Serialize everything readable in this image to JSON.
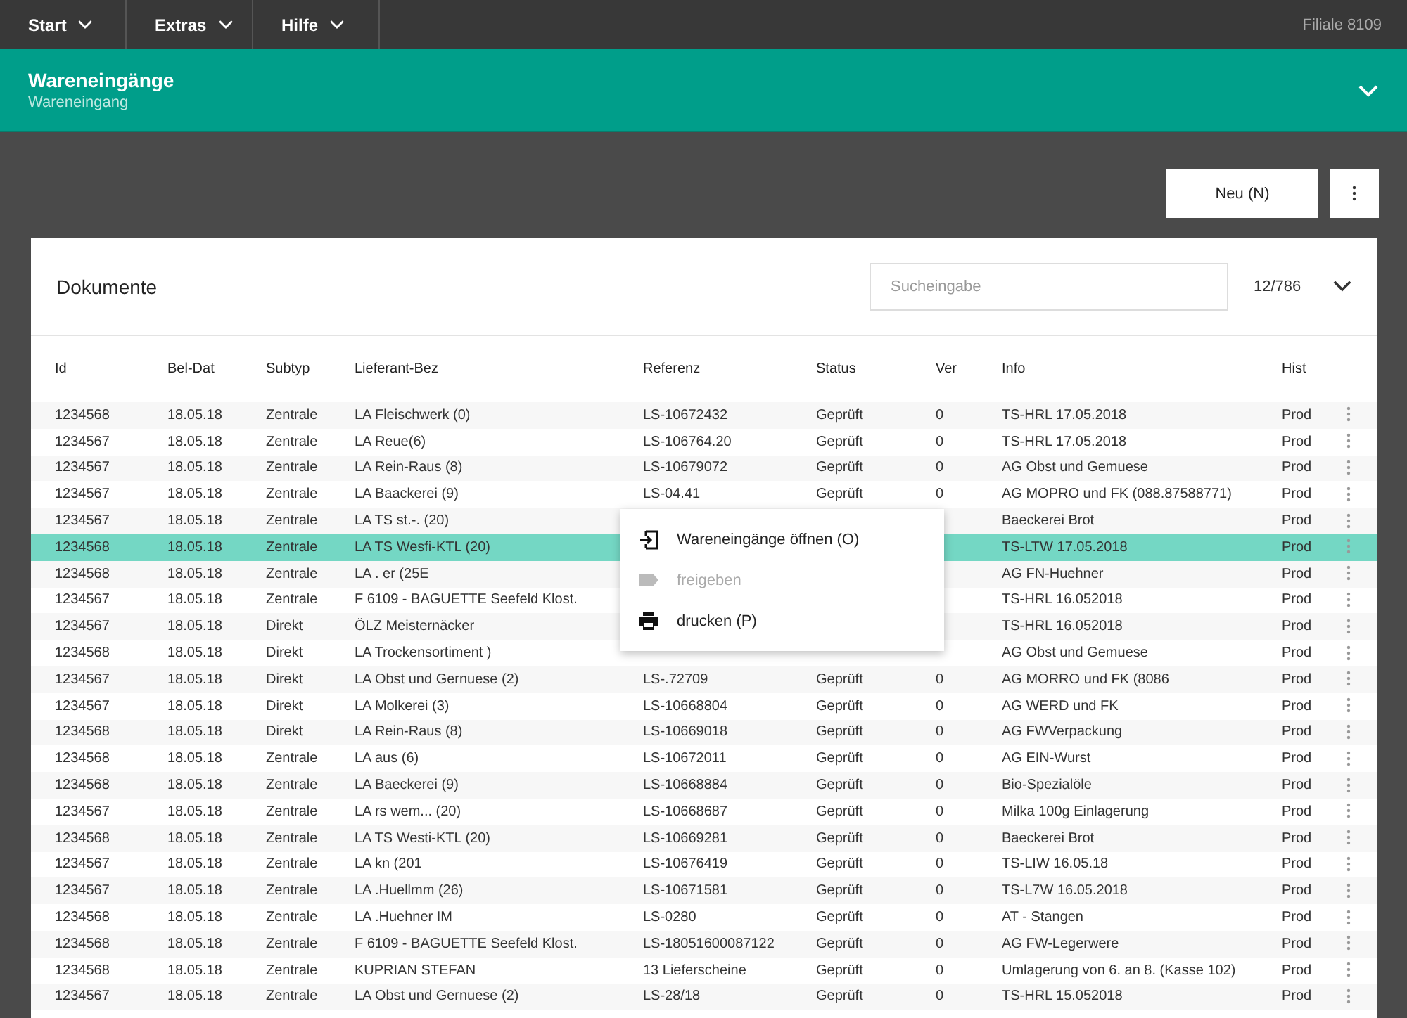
{
  "topbar": {
    "menus": [
      {
        "label": "Start"
      },
      {
        "label": "Extras"
      },
      {
        "label": "Hilfe"
      }
    ],
    "branch": "Filiale 8109"
  },
  "header": {
    "title": "Wareneingänge",
    "subtitle": "Wareneingang"
  },
  "actions": {
    "new_button": "Neu (N)"
  },
  "documents": {
    "title": "Dokumente",
    "search": {
      "placeholder": "Sucheingabe"
    },
    "count": "12/786",
    "columns": [
      "Id",
      "Bel-Dat",
      "Subtyp",
      "Lieferant-Bez",
      "Referenz",
      "Status",
      "Ver",
      "Info",
      "Hist"
    ],
    "rows": [
      {
        "selected": false,
        "cells": [
          "1234568",
          "18.05.18",
          "Zentrale",
          "LA Fleischwerk (0)",
          "LS-10672432",
          "Geprüft",
          "0",
          "TS-HRL 17.05.2018",
          "Prod"
        ]
      },
      {
        "selected": false,
        "cells": [
          "1234567",
          "18.05.18",
          "Zentrale",
          "LA Reue(6)",
          "LS-106764.20",
          "Geprüft",
          "0",
          "TS-HRL 17.05.2018",
          "Prod"
        ]
      },
      {
        "selected": false,
        "cells": [
          "1234567",
          "18.05.18",
          "Zentrale",
          "LA Rein-Raus (8)",
          "LS-10679072",
          "Geprüft",
          "0",
          "AG Obst und Gemuese",
          "Prod"
        ]
      },
      {
        "selected": false,
        "cells": [
          "1234567",
          "18.05.18",
          "Zentrale",
          "LA Baackerei (9)",
          "LS-04.41",
          "Geprüft",
          "0",
          "AG MOPRO und FK (088.87588771)",
          "Prod"
        ]
      },
      {
        "selected": false,
        "cells": [
          "1234567",
          "18.05.18",
          "Zentrale",
          "LA TS st.-. (20)",
          null,
          null,
          null,
          "Baeckerei Brot",
          "Prod"
        ]
      },
      {
        "selected": true,
        "cells": [
          "1234568",
          "18.05.18",
          "Zentrale",
          "LA TS Wesfi-KTL (20)",
          null,
          null,
          null,
          "TS-LTW 17.05.2018",
          "Prod"
        ]
      },
      {
        "selected": false,
        "cells": [
          "1234568",
          "18.05.18",
          "Zentrale",
          "LA . er (25E",
          null,
          null,
          null,
          "AG FN-Huehner",
          "Prod"
        ]
      },
      {
        "selected": false,
        "cells": [
          "1234567",
          "18.05.18",
          "Zentrale",
          "F 6109 - BAGUETTE Seefeld Klost.",
          null,
          null,
          null,
          "TS-HRL 16.052018",
          "Prod"
        ]
      },
      {
        "selected": false,
        "cells": [
          "1234567",
          "18.05.18",
          "Direkt",
          "ÖLZ Meisternäcker",
          null,
          null,
          null,
          "TS-HRL 16.052018",
          "Prod"
        ]
      },
      {
        "selected": false,
        "cells": [
          "1234568",
          "18.05.18",
          "Direkt",
          "LA Trockensortiment )",
          null,
          null,
          null,
          "AG Obst und Gemuese",
          "Prod"
        ]
      },
      {
        "selected": false,
        "cells": [
          "1234567",
          "18.05.18",
          "Direkt",
          "LA Obst und Gernuese (2)",
          "LS-.72709",
          "Geprüft",
          "0",
          "AG MORRO und FK (8086",
          "Prod"
        ]
      },
      {
        "selected": false,
        "cells": [
          "1234567",
          "18.05.18",
          "Direkt",
          "LA Molkerei (3)",
          "LS-10668804",
          "Geprüft",
          "0",
          "AG WERD und FK",
          "Prod"
        ]
      },
      {
        "selected": false,
        "cells": [
          "1234568",
          "18.05.18",
          "Direkt",
          "LA Rein-Raus (8)",
          "LS-10669018",
          "Geprüft",
          "0",
          "AG FWVerpackung",
          "Prod"
        ]
      },
      {
        "selected": false,
        "cells": [
          "1234568",
          "18.05.18",
          "Zentrale",
          "LA aus (6)",
          "LS-10672011",
          "Geprüft",
          "0",
          "AG EIN-Wurst",
          "Prod"
        ]
      },
      {
        "selected": false,
        "cells": [
          "1234568",
          "18.05.18",
          "Zentrale",
          "LA Baeckerei (9)",
          "LS-10668884",
          "Geprüft",
          "0",
          "Bio-Spezialöle",
          "Prod"
        ]
      },
      {
        "selected": false,
        "cells": [
          "1234567",
          "18.05.18",
          "Zentrale",
          "LA rs wem... (20)",
          "LS-10668687",
          "Geprüft",
          "0",
          "Milka 100g Einlagerung",
          "Prod"
        ]
      },
      {
        "selected": false,
        "cells": [
          "1234568",
          "18.05.18",
          "Zentrale",
          "LA TS Westi-KTL (20)",
          "LS-10669281",
          "Geprüft",
          "0",
          "Baeckerei Brot",
          "Prod"
        ]
      },
      {
        "selected": false,
        "cells": [
          "1234567",
          "18.05.18",
          "Zentrale",
          "LA kn (201",
          "LS-10676419",
          "Geprüft",
          "0",
          "TS-LIW 16.05.18",
          "Prod"
        ]
      },
      {
        "selected": false,
        "cells": [
          "1234567",
          "18.05.18",
          "Zentrale",
          "LA .Huellmm (26)",
          "LS-10671581",
          "Geprüft",
          "0",
          "TS-L7W 16.05.2018",
          "Prod"
        ]
      },
      {
        "selected": false,
        "cells": [
          "1234568",
          "18.05.18",
          "Zentrale",
          "LA .Huehner IM",
          "LS-0280",
          "Geprüft",
          "0",
          "AT - Stangen",
          "Prod"
        ]
      },
      {
        "selected": false,
        "cells": [
          "1234568",
          "18.05.18",
          "Zentrale",
          "F 6109 - BAGUETTE Seefeld Klost.",
          "LS-18051600087122",
          "Geprüft",
          "0",
          "AG FW-Legerwere",
          "Prod"
        ]
      },
      {
        "selected": false,
        "cells": [
          "1234568",
          "18.05.18",
          "Zentrale",
          "KUPRIAN STEFAN",
          "13 Lieferscheine",
          "Geprüft",
          "0",
          "Umlagerung von 6. an 8. (Kasse 102)",
          "Prod"
        ]
      },
      {
        "selected": false,
        "cells": [
          "1234567",
          "18.05.18",
          "Zentrale",
          "LA Obst und Gernuese (2)",
          "LS-28/18",
          "Geprüft",
          "0",
          "TS-HRL 15.052018",
          "Prod"
        ]
      }
    ]
  },
  "context_menu": {
    "items": [
      {
        "kind": "open",
        "label": "Wareneingänge öffnen (O)",
        "disabled": false
      },
      {
        "kind": "tag",
        "label": "freigeben",
        "disabled": true
      },
      {
        "kind": "print",
        "label": "drucken (P)",
        "disabled": false
      }
    ]
  }
}
